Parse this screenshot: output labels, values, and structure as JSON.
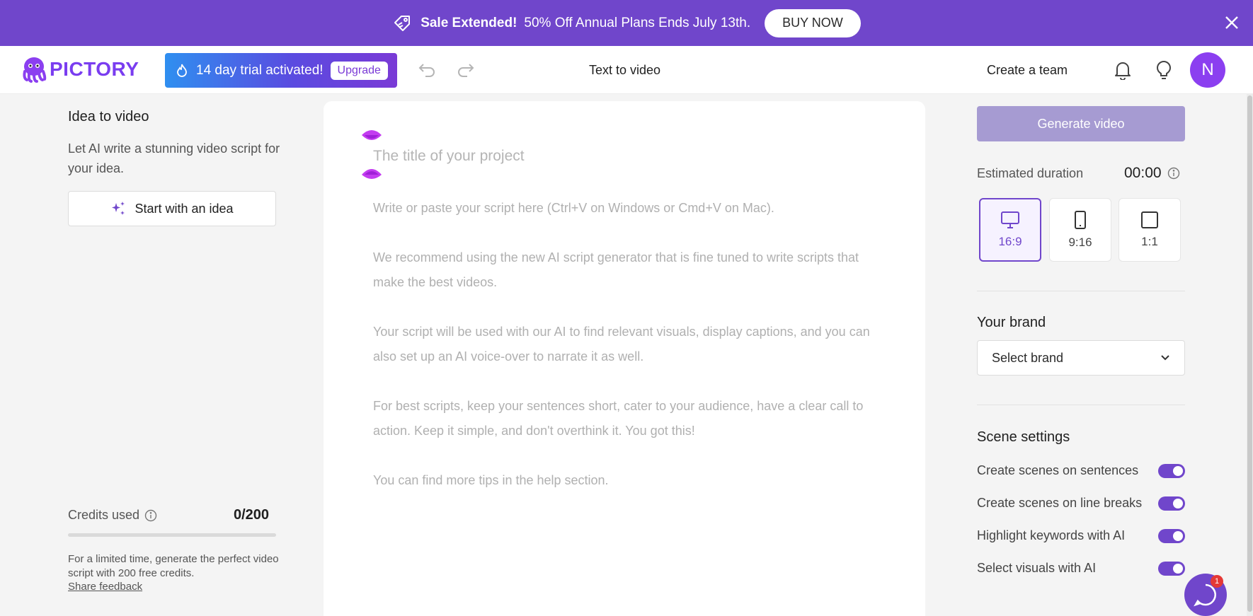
{
  "banner": {
    "bold": "Sale Extended!",
    "message": "50% Off Annual Plans Ends July 13th.",
    "buy_label": "BUY NOW",
    "tag_icon": "tag-icon",
    "close_icon": "close-icon"
  },
  "header": {
    "logo": "PICTORY",
    "trial_text": "14 day trial activated!",
    "upgrade_label": "Upgrade",
    "mode_title": "Text to video",
    "team_label": "Create a team",
    "avatar_initial": "N"
  },
  "left": {
    "title": "Idea to video",
    "description": "Let AI write a stunning video script for your idea.",
    "idea_button": "Start with an idea",
    "credits_label": "Credits used",
    "credits_value": "0/200",
    "credits_used": 0,
    "credits_total": 200,
    "note": "For a limited time, generate the perfect video script with 200 free credits.",
    "feedback": "Share feedback"
  },
  "editor": {
    "title_placeholder": "The title of your project",
    "script": [
      "Write or paste your script here (Ctrl+V on Windows or Cmd+V on Mac).",
      "We recommend using the new AI script generator that is fine tuned to write scripts that make the best videos.",
      "Your script will be used with our AI to find relevant visuals, display captions, and you can also set up an AI voice-over to narrate it as well.",
      "For best scripts, keep your sentences short, cater to your audience, have a clear call to action. Keep it simple, and don't overthink it. You got this!",
      "You can find more tips in the help section."
    ]
  },
  "right": {
    "generate_label": "Generate video",
    "estimated_label": "Estimated duration",
    "estimated_value": "00:00",
    "ratios": [
      {
        "label": "16:9",
        "active": true
      },
      {
        "label": "9:16",
        "active": false
      },
      {
        "label": "1:1",
        "active": false
      }
    ],
    "brand_title": "Your brand",
    "brand_select": "Select brand",
    "scene_title": "Scene settings",
    "toggles": [
      {
        "label": "Create scenes on sentences",
        "on": true
      },
      {
        "label": "Create scenes on line breaks",
        "on": true
      },
      {
        "label": "Highlight keywords with AI",
        "on": true
      },
      {
        "label": "Select visuals with AI",
        "on": true
      }
    ]
  },
  "chat": {
    "badge": "1"
  },
  "colors": {
    "brand": "#7046cb",
    "generate_disabled": "#a69bd2"
  }
}
